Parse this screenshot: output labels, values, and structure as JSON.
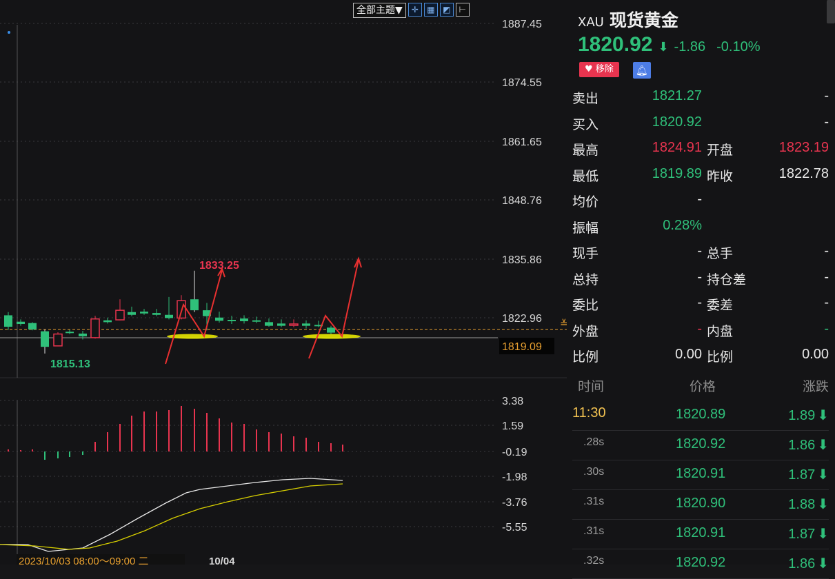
{
  "toolbar": {
    "theme_label": "全部主题▼",
    "buttons": [
      "crosshair-icon",
      "layout-icon",
      "chart-mode-icon",
      "expand-icon"
    ]
  },
  "chart": {
    "main_price_labels": [
      "1887.45",
      "1874.55",
      "1861.65",
      "1848.76",
      "1835.86",
      "1822.96"
    ],
    "current_price_tag": "1819.09",
    "high_annotation": "1833.25",
    "low_annotation": "1815.13",
    "indicator_labels": [
      "3.38",
      "1.59",
      "-0.19",
      "-1.98",
      "-3.76",
      "-5.55"
    ],
    "date_label": "2023/10/03 08:00～09:00 二",
    "date_label2": "10/04",
    "colors": {
      "up": "#e8344f",
      "down": "#2fc07a",
      "dash_line": "#e8a030",
      "highlight": "#e8e800",
      "dif": "#e8e8e8",
      "dea": "#d8d000"
    }
  },
  "panel": {
    "code": "XAU",
    "name": "现货黄金",
    "price": "1820.92",
    "change": "-1.86",
    "change_pct": "-0.10%",
    "remove_label": "移除",
    "quote_rows": [
      {
        "l1": "卖出",
        "v1": "1821.27",
        "v1c": "green",
        "l2": "",
        "v2": "-",
        "v2c": "white"
      },
      {
        "l1": "买入",
        "v1": "1820.92",
        "v1c": "green",
        "l2": "",
        "v2": "-",
        "v2c": "white"
      },
      {
        "l1": "最高",
        "v1": "1824.91",
        "v1c": "red",
        "l2": "开盘",
        "v2": "1823.19",
        "v2c": "red"
      },
      {
        "l1": "最低",
        "v1": "1819.89",
        "v1c": "green",
        "l2": "昨收",
        "v2": "1822.78",
        "v2c": "white"
      },
      {
        "l1": "均价",
        "v1": "-",
        "v1c": "white",
        "l2": "",
        "v2": "",
        "v2c": "white"
      },
      {
        "l1": "振幅",
        "v1": "0.28%",
        "v1c": "green",
        "l2": "",
        "v2": "",
        "v2c": "white"
      },
      {
        "l1": "现手",
        "v1": "-",
        "v1c": "white",
        "l2": "总手",
        "v2": "-",
        "v2c": "white"
      },
      {
        "l1": "总持",
        "v1": "-",
        "v1c": "white",
        "l2": "持仓差",
        "v2": "-",
        "v2c": "white"
      },
      {
        "l1": "委比",
        "v1": "-",
        "v1c": "white",
        "l2": "委差",
        "v2": "-",
        "v2c": "white"
      },
      {
        "l1": "外盘",
        "v1": "-",
        "v1c": "red",
        "l2": "内盘",
        "v2": "-",
        "v2c": "green"
      },
      {
        "l1": "比例",
        "v1": "0.00",
        "v1c": "white",
        "l2": "比例",
        "v2": "0.00",
        "v2c": "white"
      }
    ],
    "ticks_header": {
      "time": "时间",
      "price": "价格",
      "change": "涨跌"
    },
    "ticks": [
      {
        "time": "11:30",
        "price": "1820.89",
        "change": "1.89"
      },
      {
        "time": ".28s",
        "price": "1820.92",
        "change": "1.86"
      },
      {
        "time": ".30s",
        "price": "1820.91",
        "change": "1.87"
      },
      {
        "time": ".31s",
        "price": "1820.90",
        "change": "1.88"
      },
      {
        "time": ".31s",
        "price": "1820.91",
        "change": "1.87"
      },
      {
        "time": ".32s",
        "price": "1820.92",
        "change": "1.86"
      }
    ]
  }
}
